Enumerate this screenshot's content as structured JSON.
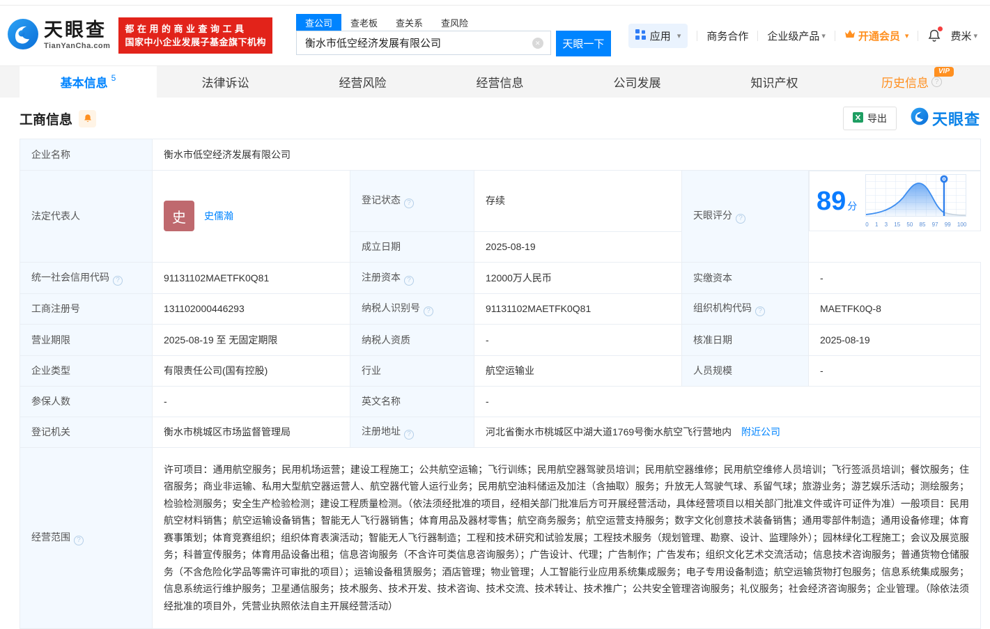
{
  "header": {
    "logo": {
      "name": "天眼查",
      "domain": "TianYanCha.com"
    },
    "slogan": {
      "line1": "都在用的商业查询工具",
      "line2": "国家中小企业发展子基金旗下机构"
    },
    "search": {
      "tabs": [
        {
          "label": "查公司"
        },
        {
          "label": "查老板"
        },
        {
          "label": "查关系"
        },
        {
          "label": "查风险"
        }
      ],
      "value": "衡水市低空经济发展有限公司",
      "button": "天眼一下"
    },
    "nav": {
      "apps": "应用",
      "cooperation": "商务合作",
      "enterprise": "企业级产品",
      "vip": "开通会员",
      "user": "费米"
    }
  },
  "tabs": [
    {
      "label": "基本信息",
      "count": "5"
    },
    {
      "label": "法律诉讼"
    },
    {
      "label": "经营风险"
    },
    {
      "label": "经营信息"
    },
    {
      "label": "公司发展"
    },
    {
      "label": "知识产权"
    },
    {
      "label": "历史信息",
      "badge": "VIP"
    }
  ],
  "section": {
    "title": "工商信息",
    "export_label": "导出",
    "brand_mark": "天眼查"
  },
  "info": {
    "company_name": {
      "label": "企业名称",
      "value": "衡水市低空经济发展有限公司"
    },
    "legal_rep": {
      "label": "法定代表人",
      "avatar": "史",
      "name": "史儒瀚"
    },
    "reg_status": {
      "label": "登记状态",
      "value": "存续"
    },
    "est_date": {
      "label": "成立日期",
      "value": "2025-08-19"
    },
    "score": {
      "label": "天眼评分",
      "value": "89",
      "unit": "分",
      "axis": [
        "0",
        "1",
        "3",
        "15",
        "50",
        "85",
        "97",
        "99",
        "100"
      ]
    },
    "uscc": {
      "label": "统一社会信用代码",
      "value": "91131102MAETFK0Q81"
    },
    "reg_capital": {
      "label": "注册资本",
      "value": "12000万人民币"
    },
    "paid_capital": {
      "label": "实缴资本",
      "value": "-"
    },
    "reg_number": {
      "label": "工商注册号",
      "value": "131102000446293"
    },
    "taxpayer_id": {
      "label": "纳税人识别号",
      "value": "91131102MAETFK0Q81"
    },
    "org_code": {
      "label": "组织机构代码",
      "value": "MAETFK0Q-8"
    },
    "business_term": {
      "label": "营业期限",
      "value": "2025-08-19 至 无固定期限"
    },
    "taxpayer_qual": {
      "label": "纳税人资质",
      "value": "-"
    },
    "approval_date": {
      "label": "核准日期",
      "value": "2025-08-19"
    },
    "company_type": {
      "label": "企业类型",
      "value": "有限责任公司(国有控股)"
    },
    "industry": {
      "label": "行业",
      "value": "航空运输业"
    },
    "staff_size": {
      "label": "人员规模",
      "value": "-"
    },
    "insured_count": {
      "label": "参保人数",
      "value": "-"
    },
    "english_name": {
      "label": "英文名称",
      "value": "-"
    },
    "reg_authority": {
      "label": "登记机关",
      "value": "衡水市桃城区市场监督管理局"
    },
    "reg_address": {
      "label": "注册地址",
      "value": "河北省衡水市桃城区中湖大道1769号衡水航空飞行营地内",
      "nearby_link": "附近公司"
    },
    "business_scope": {
      "label": "经营范围",
      "value": "许可项目：通用航空服务；民用机场运营；建设工程施工；公共航空运输；飞行训练；民用航空器驾驶员培训；民用航空器维修；民用航空维修人员培训；飞行签派员培训；餐饮服务；住宿服务；商业非运输、私用大型航空器运营人、航空器代管人运行业务；民用航空油料储运及加注（含抽取）服务；升放无人驾驶气球、系留气球；旅游业务；游艺娱乐活动；测绘服务；检验检测服务；安全生产检验检测；建设工程质量检测。（依法须经批准的项目，经相关部门批准后方可开展经营活动，具体经营项目以相关部门批准文件或许可证件为准）一般项目：民用航空材料销售；航空运输设备销售；智能无人飞行器销售；体育用品及器材零售；航空商务服务；航空运营支持服务；数字文化创意技术装备销售；通用零部件制造；通用设备修理；体育赛事策划；体育竞赛组织；组织体育表演活动；智能无人飞行器制造；工程和技术研究和试验发展；工程技术服务（规划管理、勘察、设计、监理除外）；园林绿化工程施工；会议及展览服务；科普宣传服务；体育用品设备出租；信息咨询服务（不含许可类信息咨询服务）；广告设计、代理；广告制作；广告发布；组织文化艺术交流活动；信息技术咨询服务；普通货物仓储服务（不含危险化学品等需许可审批的项目）；运输设备租赁服务；酒店管理；物业管理；人工智能行业应用系统集成服务；电子专用设备制造；航空运输货物打包服务；信息系统集成服务；信息系统运行维护服务；卫星通信服务；技术服务、技术开发、技术咨询、技术交流、技术转让、技术推广；公共安全管理咨询服务；礼仪服务；社会经济咨询服务；企业管理。（除依法须经批准的项目外，凭营业执照依法自主开展经营活动）"
    }
  }
}
